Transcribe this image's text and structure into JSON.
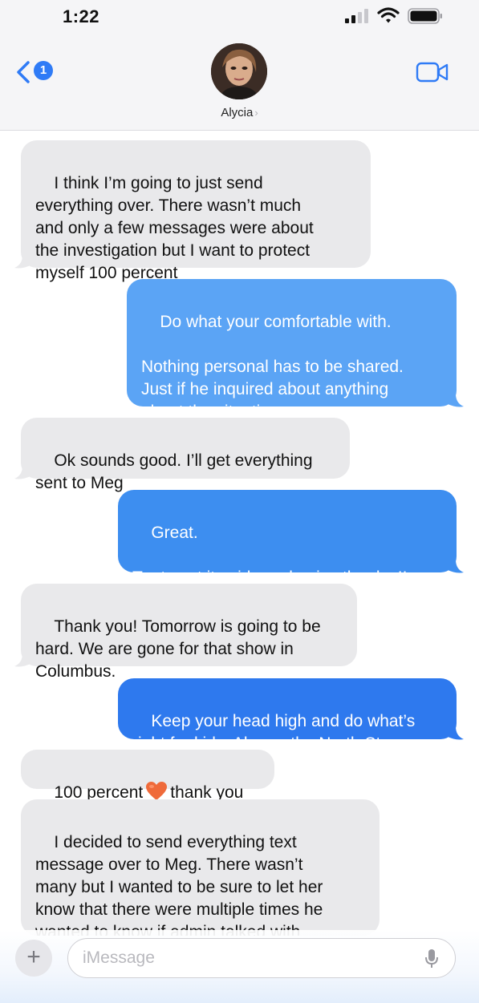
{
  "status_bar": {
    "time": "1:22"
  },
  "header": {
    "back_badge": "1",
    "contact_name": "Alycia",
    "contact_chevron": "›"
  },
  "messages": [
    {
      "direction": "in",
      "text": "I think I’m going to just send\neverything over. There wasn’t much\nand only a few messages were about\nthe investigation but I want to protect\nmyself 100 percent"
    },
    {
      "direction": "out",
      "text": "Do what your comfortable with.\n\nNothing personal has to be shared.\nJust if he inquired about anything\nabout the situation."
    },
    {
      "direction": "in",
      "text": "Ok sounds good. I’ll get everything\nsent to Meg"
    },
    {
      "direction": "out",
      "text": "Great.\n\nTry to set it aside and enjoy the day!!"
    },
    {
      "direction": "in",
      "text": "Thank you! Tomorrow is going to be\nhard. We are gone for that show in\nColumbus."
    },
    {
      "direction": "out",
      "text": "Keep your head high and do what’s\nright for kids. Always the North Star."
    },
    {
      "direction": "in",
      "text_before": "100 percent",
      "emoji": "heart-emoji",
      "text_after": "thank you"
    },
    {
      "direction": "in",
      "text": "I decided to send everything text\nmessage over to Meg. There wasn’t\nmany but I wanted to be sure to let her\nknow that there were multiple times he\nwanted to know if admin talked with\nme and I didn’t engage."
    }
  ],
  "composer": {
    "placeholder": "iMessage",
    "plus": "+"
  },
  "colors": {
    "incoming": "#e9e9eb",
    "outgoing_blue": "#3d8ef0",
    "badge": "#2f7bf6"
  }
}
